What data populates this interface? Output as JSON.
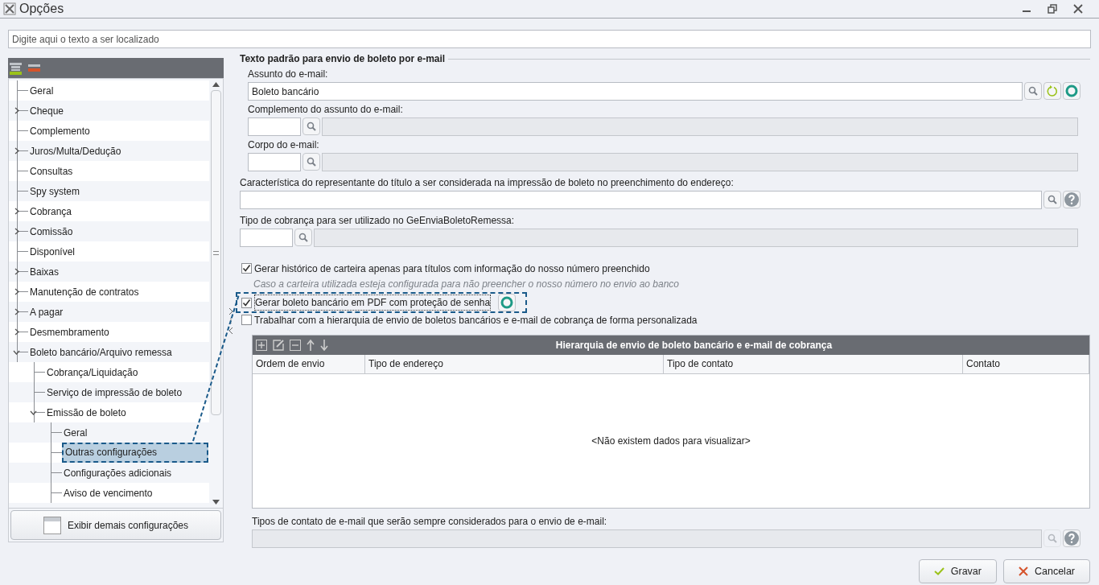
{
  "window": {
    "title": "Opções"
  },
  "search": {
    "placeholder": "Digite aqui o texto a ser localizado"
  },
  "tree": {
    "items": [
      {
        "label": "Geral",
        "selected": false
      },
      {
        "label": "Cheque",
        "expanded": false,
        "selected": false
      },
      {
        "label": "Complemento",
        "selected": false
      },
      {
        "label": "Juros/Multa/Dedução",
        "expanded": false,
        "selected": false
      },
      {
        "label": "Consultas",
        "selected": false
      },
      {
        "label": "Spy system",
        "selected": false
      },
      {
        "label": "Cobrança",
        "expanded": false,
        "selected": false
      },
      {
        "label": "Comissão",
        "expanded": false,
        "selected": false
      },
      {
        "label": "Disponível",
        "selected": false
      },
      {
        "label": "Baixas",
        "expanded": false,
        "selected": false
      },
      {
        "label": "Manutenção de contratos",
        "expanded": false,
        "selected": false
      },
      {
        "label": "A pagar",
        "expanded": false,
        "selected": false
      },
      {
        "label": "Desmembramento",
        "expanded": false,
        "selected": false
      },
      {
        "label": "Boleto bancário/Arquivo remessa",
        "expanded": true,
        "selected": false,
        "children": [
          {
            "label": "Cobrança/Liquidação",
            "selected": false
          },
          {
            "label": "Serviço de impressão de boleto",
            "selected": false
          },
          {
            "label": "Emissão de boleto",
            "expanded": true,
            "selected": false,
            "children": [
              {
                "label": "Geral",
                "selected": false
              },
              {
                "label": "Outras configurações",
                "selected": true
              },
              {
                "label": "Configurações adicionais",
                "selected": false
              },
              {
                "label": "Aviso de vencimento",
                "selected": false
              }
            ]
          }
        ]
      }
    ]
  },
  "show_more_button": {
    "label": "Exibir demais configurações"
  },
  "section": {
    "title": "Texto padrão para envio de boleto por e-mail",
    "fields": [
      {
        "label": "Assunto do e-mail:",
        "kind": "text",
        "value": "Boleto bancário"
      },
      {
        "label": "Complemento do assunto do e-mail:",
        "kind": "lookup"
      },
      {
        "label": "Corpo do e-mail:",
        "kind": "lookup"
      }
    ]
  },
  "fields": [
    {
      "label": "Característica do representante do título a ser considerada na impressão de boleto no preenchimento do endereço:",
      "kind": "search"
    },
    {
      "label": "Tipo de cobrança para ser utilizado no GeEnviaBoletoRemessa:",
      "kind": "lookup"
    }
  ],
  "checkboxes": [
    {
      "label": "Gerar histórico de carteira apenas para títulos com informação do nosso número preenchido",
      "checked": true,
      "focused": false,
      "hint": "Caso a carteira utilizada esteja configurada para não preencher o nosso número no envio ao banco"
    },
    {
      "label": "Gerar boleto bancário em PDF com proteção de senha",
      "checked": true,
      "focused": true
    },
    {
      "label": "Trabalhar com a hierarquia de envio de boletos bancários e e-mail de cobrança de forma personalizada",
      "checked": false,
      "focused": false
    }
  ],
  "grid": {
    "title": "Hierarquia de envio de boleto bancário e e-mail de cobrança",
    "columns": [
      "Ordem de envio",
      "Tipo de endereço",
      "Tipo de contato",
      "Contato"
    ],
    "empty_message": "<Não existem dados para visualizar>"
  },
  "contact_types": {
    "label": "Tipos de contato de e-mail que serão sempre considerados para o envio de e-mail:",
    "disabled": true
  },
  "buttons": [
    {
      "label": "Gravar",
      "kind": "save"
    },
    {
      "label": "Cancelar",
      "kind": "cancel"
    }
  ]
}
